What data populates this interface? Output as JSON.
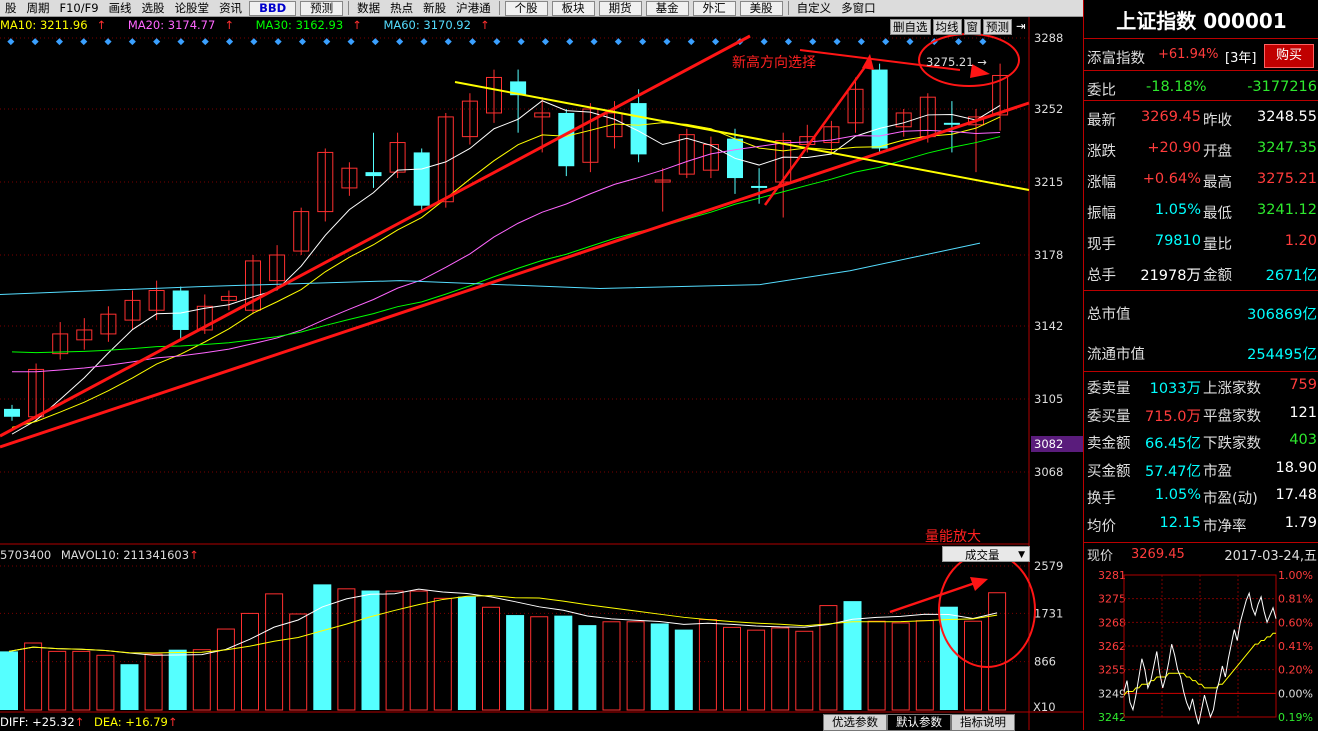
{
  "toolbar": {
    "items": [
      "股",
      "周期",
      "F10/F9",
      "画线",
      "选股",
      "论股堂",
      "资讯",
      "BBD",
      "预测",
      "数据",
      "热点",
      "新股",
      "沪港通",
      "个股",
      "板块",
      "期货",
      "基金",
      "外汇",
      "美股",
      "自定义",
      "多窗口"
    ]
  },
  "ma_legend": {
    "ma10": "MA10: 3211.96",
    "ma20": "MA20: 3174.77",
    "ma30": "MA30: 3162.93",
    "ma60": "MA60: 3170.92",
    "arrow": "↑",
    "colors": {
      "ma10": "#ffff00",
      "ma20": "#ff66ff",
      "ma30": "#00ff00",
      "ma60": "#55ddff"
    }
  },
  "chart_tools": [
    "删自选",
    "均线",
    "窗",
    "预测"
  ],
  "price_axis": [
    "3288",
    "3252",
    "3215",
    "3178",
    "3142",
    "3105",
    "3068"
  ],
  "current_price_tag": "3082",
  "high_label": "3275.21",
  "annotations": {
    "new_high": "新高方向选择",
    "volume": "量能放大"
  },
  "volume": {
    "legend_left": "5703400",
    "mavol": "MAVOL10: 211341603",
    "arrow": "↑",
    "select": "成交量",
    "axis": [
      "2579",
      "1731",
      "866"
    ],
    "unit": "X10"
  },
  "macd": {
    "diff": "DIFF: +25.32",
    "dea": "DEA: +16.79",
    "arrow": "↑"
  },
  "bottom_tabs": [
    "优选参数",
    "默认参数",
    "指标说明"
  ],
  "candles": [
    {
      "o": 3100,
      "c": 3096,
      "h": 3102,
      "l": 3094
    },
    {
      "o": 3096,
      "c": 3120,
      "h": 3123,
      "l": 3094
    },
    {
      "o": 3128,
      "c": 3138,
      "h": 3144,
      "l": 3125
    },
    {
      "o": 3135,
      "c": 3140,
      "h": 3146,
      "l": 3130
    },
    {
      "o": 3138,
      "c": 3148,
      "h": 3152,
      "l": 3134
    },
    {
      "o": 3145,
      "c": 3155,
      "h": 3160,
      "l": 3140
    },
    {
      "o": 3150,
      "c": 3160,
      "h": 3165,
      "l": 3145
    },
    {
      "o": 3160,
      "c": 3140,
      "h": 3162,
      "l": 3135
    },
    {
      "o": 3140,
      "c": 3152,
      "h": 3158,
      "l": 3138
    },
    {
      "o": 3155,
      "c": 3157,
      "h": 3160,
      "l": 3150
    },
    {
      "o": 3150,
      "c": 3175,
      "h": 3178,
      "l": 3148
    },
    {
      "o": 3165,
      "c": 3178,
      "h": 3183,
      "l": 3160
    },
    {
      "o": 3180,
      "c": 3200,
      "h": 3202,
      "l": 3178
    },
    {
      "o": 3200,
      "c": 3230,
      "h": 3232,
      "l": 3195
    },
    {
      "o": 3212,
      "c": 3222,
      "h": 3225,
      "l": 3208
    },
    {
      "o": 3220,
      "c": 3218,
      "h": 3240,
      "l": 3212
    },
    {
      "o": 3220,
      "c": 3235,
      "h": 3240,
      "l": 3217
    },
    {
      "o": 3230,
      "c": 3203,
      "h": 3232,
      "l": 3200
    },
    {
      "o": 3205,
      "c": 3248,
      "h": 3250,
      "l": 3202
    },
    {
      "o": 3238,
      "c": 3256,
      "h": 3260,
      "l": 3234
    },
    {
      "o": 3250,
      "c": 3268,
      "h": 3272,
      "l": 3245
    },
    {
      "o": 3266,
      "c": 3259,
      "h": 3272,
      "l": 3240
    },
    {
      "o": 3248,
      "c": 3250,
      "h": 3258,
      "l": 3230
    },
    {
      "o": 3250,
      "c": 3223,
      "h": 3252,
      "l": 3218
    },
    {
      "o": 3225,
      "c": 3252,
      "h": 3255,
      "l": 3220
    },
    {
      "o": 3238,
      "c": 3250,
      "h": 3256,
      "l": 3232
    },
    {
      "o": 3255,
      "c": 3229,
      "h": 3262,
      "l": 3225
    },
    {
      "o": 3215,
      "c": 3216,
      "h": 3222,
      "l": 3200
    },
    {
      "o": 3219,
      "c": 3239,
      "h": 3242,
      "l": 3217
    },
    {
      "o": 3221,
      "c": 3234,
      "h": 3238,
      "l": 3217
    },
    {
      "o": 3237,
      "c": 3217,
      "h": 3242,
      "l": 3209
    },
    {
      "o": 3213,
      "c": 3212,
      "h": 3222,
      "l": 3204
    },
    {
      "o": 3215,
      "c": 3236,
      "h": 3240,
      "l": 3197
    },
    {
      "o": 3234,
      "c": 3238,
      "h": 3244,
      "l": 3230
    },
    {
      "o": 3235,
      "c": 3243,
      "h": 3246,
      "l": 3230
    },
    {
      "o": 3245,
      "c": 3262,
      "h": 3268,
      "l": 3240
    },
    {
      "o": 3272,
      "c": 3232,
      "h": 3275,
      "l": 3230
    },
    {
      "o": 3243,
      "c": 3250,
      "h": 3252,
      "l": 3238
    },
    {
      "o": 3238,
      "c": 3258,
      "h": 3260,
      "l": 3235
    },
    {
      "o": 3245,
      "c": 3244,
      "h": 3256,
      "l": 3230
    },
    {
      "o": 3244,
      "c": 3248,
      "h": 3252,
      "l": 3220
    },
    {
      "o": 3249,
      "c": 3269,
      "h": 3275,
      "l": 3241
    }
  ],
  "volumes": [
    {
      "v": 1050,
      "up": false
    },
    {
      "v": 1200,
      "up": true
    },
    {
      "v": 1050,
      "up": true
    },
    {
      "v": 1050,
      "up": true
    },
    {
      "v": 980,
      "up": true
    },
    {
      "v": 820,
      "up": false
    },
    {
      "v": 1000,
      "up": true
    },
    {
      "v": 1080,
      "up": false
    },
    {
      "v": 1080,
      "up": true
    },
    {
      "v": 1450,
      "up": true
    },
    {
      "v": 1730,
      "up": true
    },
    {
      "v": 2080,
      "up": true
    },
    {
      "v": 1720,
      "up": true
    },
    {
      "v": 2250,
      "up": false
    },
    {
      "v": 2170,
      "up": true
    },
    {
      "v": 2140,
      "up": false
    },
    {
      "v": 2130,
      "up": true
    },
    {
      "v": 2130,
      "up": true
    },
    {
      "v": 2000,
      "up": true
    },
    {
      "v": 2030,
      "up": false
    },
    {
      "v": 1840,
      "up": true
    },
    {
      "v": 1700,
      "up": false
    },
    {
      "v": 1670,
      "up": true
    },
    {
      "v": 1690,
      "up": false
    },
    {
      "v": 1520,
      "up": false
    },
    {
      "v": 1580,
      "up": true
    },
    {
      "v": 1580,
      "up": true
    },
    {
      "v": 1550,
      "up": false
    },
    {
      "v": 1440,
      "up": false
    },
    {
      "v": 1620,
      "up": true
    },
    {
      "v": 1480,
      "up": true
    },
    {
      "v": 1430,
      "up": true
    },
    {
      "v": 1470,
      "up": true
    },
    {
      "v": 1410,
      "up": true
    },
    {
      "v": 1870,
      "up": true
    },
    {
      "v": 1950,
      "up": false
    },
    {
      "v": 1590,
      "up": true
    },
    {
      "v": 1560,
      "up": true
    },
    {
      "v": 1600,
      "up": true
    },
    {
      "v": 1850,
      "up": false
    },
    {
      "v": 1590,
      "up": true
    },
    {
      "v": 2100,
      "up": true
    }
  ],
  "right_panel": {
    "title": "上证指数 000001",
    "fortune_label": "添富指数",
    "fortune_value": "+61.94%",
    "fortune_period": "[3年]",
    "buy_label": "购买",
    "weibi_label": "委比",
    "weibi_value": "-18.18%",
    "weibi_diff": "-3177216",
    "rows": [
      {
        "l1": "最新",
        "v1": "3269.45",
        "c1": "red",
        "l2": "昨收",
        "v2": "3248.55",
        "c2": "wht"
      },
      {
        "l1": "涨跌",
        "v1": "+20.90",
        "c1": "red",
        "l2": "开盘",
        "v2": "3247.35",
        "c2": "green"
      },
      {
        "l1": "涨幅",
        "v1": "+0.64%",
        "c1": "red",
        "l2": "最高",
        "v2": "3275.21",
        "c2": "red"
      },
      {
        "l1": "振幅",
        "v1": "1.05%",
        "c1": "cyan",
        "l2": "最低",
        "v2": "3241.12",
        "c2": "green"
      },
      {
        "l1": "现手",
        "v1": "79810",
        "c1": "cyan",
        "l2": "量比",
        "v2": "1.20",
        "c2": "red"
      },
      {
        "l1": "总手",
        "v1": "21978万",
        "c1": "wht",
        "l2": "金额",
        "v2": "2671亿",
        "c2": "cyan"
      }
    ],
    "total_cap_label": "总市值",
    "total_cap_value": "306869亿",
    "float_cap_label": "流通市值",
    "float_cap_value": "254495亿",
    "rows2": [
      {
        "l1": "委卖量",
        "v1": "1033万",
        "c1": "cyan",
        "l2": "上涨家数",
        "v2": "759",
        "c2": "red"
      },
      {
        "l1": "委买量",
        "v1": "715.0万",
        "c1": "red",
        "l2": "平盘家数",
        "v2": "121",
        "c2": "wht"
      },
      {
        "l1": "卖金额",
        "v1": "66.45亿",
        "c1": "cyan",
        "l2": "下跌家数",
        "v2": "403",
        "c2": "green"
      },
      {
        "l1": "买金额",
        "v1": "57.47亿",
        "c1": "cyan",
        "l2": "市盈",
        "v2": "18.90",
        "c2": "wht"
      },
      {
        "l1": "换手",
        "v1": "1.05%",
        "c1": "cyan",
        "l2": "市盈(动)",
        "v2": "17.48",
        "c2": "wht"
      },
      {
        "l1": "均价",
        "v1": "12.15",
        "c1": "cyan",
        "l2": "市净率",
        "v2": "1.79",
        "c2": "wht"
      }
    ],
    "mini": {
      "label": "现价",
      "price": "3269.45",
      "date": "2017-03-24,五",
      "left_axis": [
        "3281",
        "3275",
        "3268",
        "3262",
        "3255",
        "3249",
        "3242"
      ],
      "right_axis": [
        "1.00%",
        "0.81%",
        "0.60%",
        "0.41%",
        "0.20%",
        "0.00%",
        "0.19%"
      ]
    }
  }
}
